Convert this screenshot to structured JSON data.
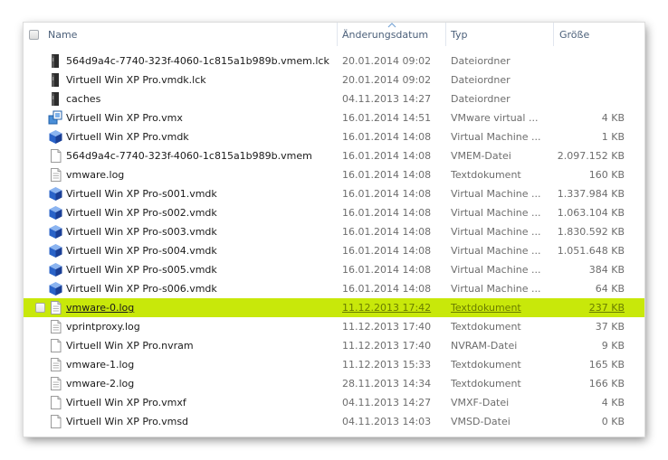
{
  "columns": {
    "name": "Name",
    "date": "Änderungsdatum",
    "type": "Typ",
    "size": "Größe"
  },
  "sort": {
    "column": "date",
    "icon": "sort-arrow-icon"
  },
  "colors": {
    "selection": "#c8e80a",
    "header_text": "#4c607a",
    "detail_text": "#6d6d6d"
  },
  "selected_index": 13,
  "files": [
    {
      "name": "564d9a4c-7740-323f-4060-1c815a1b989b.vmem.lck",
      "date": "20.01.2014 09:02",
      "type": "Dateiordner",
      "size": "",
      "icon": "folder-dark-icon"
    },
    {
      "name": "Virtuell Win XP Pro.vmdk.lck",
      "date": "20.01.2014 09:02",
      "type": "Dateiordner",
      "size": "",
      "icon": "folder-dark-icon"
    },
    {
      "name": "caches",
      "date": "04.11.2013 14:27",
      "type": "Dateiordner",
      "size": "",
      "icon": "folder-dark-icon"
    },
    {
      "name": "Virtuell Win XP Pro.vmx",
      "date": "16.01.2014 14:51",
      "type": "VMware virtual ...",
      "size": "4 KB",
      "icon": "vmx-config-icon"
    },
    {
      "name": "Virtuell Win XP Pro.vmdk",
      "date": "16.01.2014 14:08",
      "type": "Virtual Machine ...",
      "size": "1 KB",
      "icon": "vmdk-cube-icon"
    },
    {
      "name": "564d9a4c-7740-323f-4060-1c815a1b989b.vmem",
      "date": "16.01.2014 14:08",
      "type": "VMEM-Datei",
      "size": "2.097.152 KB",
      "icon": "generic-file-icon"
    },
    {
      "name": "vmware.log",
      "date": "16.01.2014 14:08",
      "type": "Textdokument",
      "size": "160 KB",
      "icon": "text-document-icon"
    },
    {
      "name": "Virtuell Win XP Pro-s001.vmdk",
      "date": "16.01.2014 14:08",
      "type": "Virtual Machine ...",
      "size": "1.337.984 KB",
      "icon": "vmdk-cube-icon"
    },
    {
      "name": "Virtuell Win XP Pro-s002.vmdk",
      "date": "16.01.2014 14:08",
      "type": "Virtual Machine ...",
      "size": "1.063.104 KB",
      "icon": "vmdk-cube-icon"
    },
    {
      "name": "Virtuell Win XP Pro-s003.vmdk",
      "date": "16.01.2014 14:08",
      "type": "Virtual Machine ...",
      "size": "1.830.592 KB",
      "icon": "vmdk-cube-icon"
    },
    {
      "name": "Virtuell Win XP Pro-s004.vmdk",
      "date": "16.01.2014 14:08",
      "type": "Virtual Machine ...",
      "size": "1.051.648 KB",
      "icon": "vmdk-cube-icon"
    },
    {
      "name": "Virtuell Win XP Pro-s005.vmdk",
      "date": "16.01.2014 14:08",
      "type": "Virtual Machine ...",
      "size": "384 KB",
      "icon": "vmdk-cube-icon"
    },
    {
      "name": "Virtuell Win XP Pro-s006.vmdk",
      "date": "16.01.2014 14:08",
      "type": "Virtual Machine ...",
      "size": "64 KB",
      "icon": "vmdk-cube-icon"
    },
    {
      "name": "vmware-0.log",
      "date": "11.12.2013 17:42",
      "type": "Textdokument",
      "size": "237 KB",
      "icon": "text-document-icon"
    },
    {
      "name": "vprintproxy.log",
      "date": "11.12.2013 17:40",
      "type": "Textdokument",
      "size": "37 KB",
      "icon": "text-document-icon"
    },
    {
      "name": "Virtuell Win XP Pro.nvram",
      "date": "11.12.2013 17:40",
      "type": "NVRAM-Datei",
      "size": "9 KB",
      "icon": "generic-file-icon"
    },
    {
      "name": "vmware-1.log",
      "date": "11.12.2013 15:33",
      "type": "Textdokument",
      "size": "165 KB",
      "icon": "text-document-icon"
    },
    {
      "name": "vmware-2.log",
      "date": "28.11.2013 14:34",
      "type": "Textdokument",
      "size": "166 KB",
      "icon": "text-document-icon"
    },
    {
      "name": "Virtuell Win XP Pro.vmxf",
      "date": "04.11.2013 14:27",
      "type": "VMXF-Datei",
      "size": "4 KB",
      "icon": "generic-file-icon"
    },
    {
      "name": "Virtuell Win XP Pro.vmsd",
      "date": "04.11.2013 14:03",
      "type": "VMSD-Datei",
      "size": "0 KB",
      "icon": "generic-file-icon"
    }
  ]
}
